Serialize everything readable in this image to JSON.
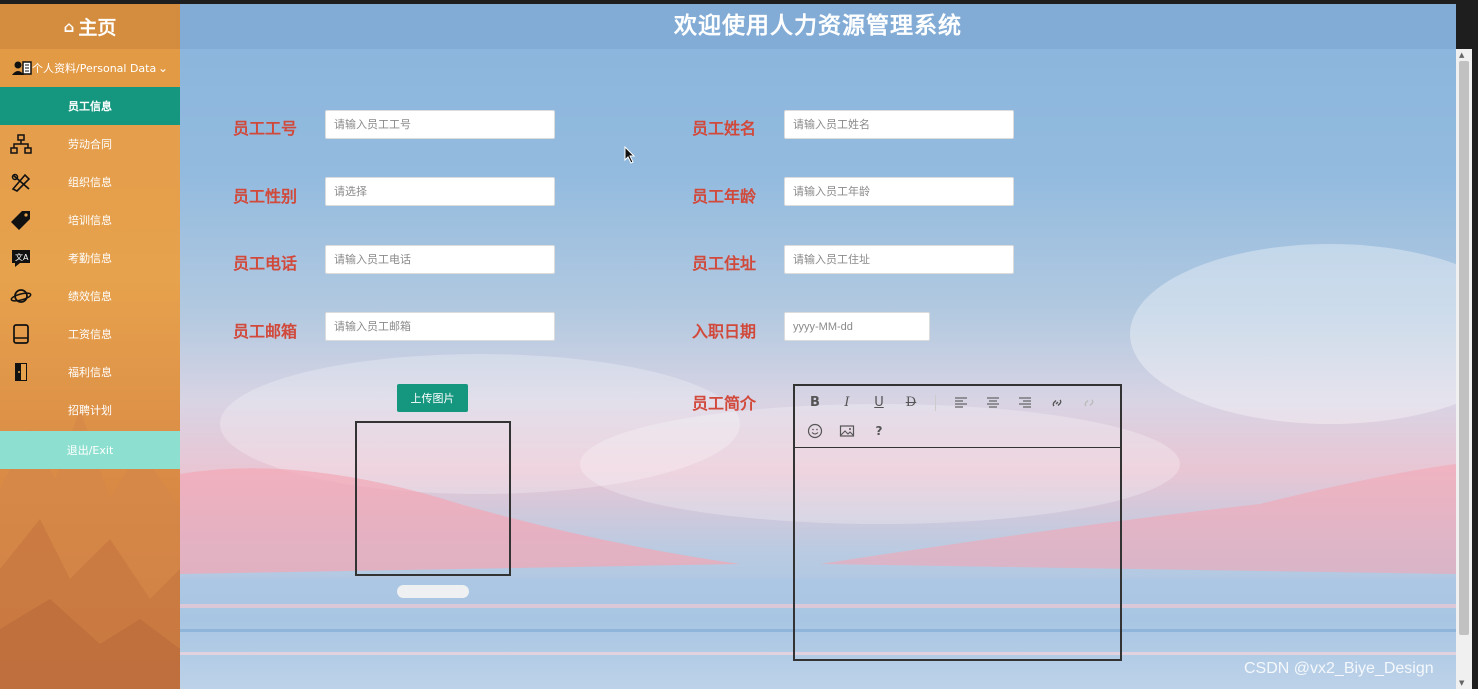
{
  "sidebar": {
    "home_label": "主页",
    "personal_label": "个人资料/Personal Data",
    "items": [
      {
        "label": "员工信息",
        "icon": "none"
      },
      {
        "label": "劳动合同",
        "icon": "hierarchy-icon"
      },
      {
        "label": "组织信息",
        "icon": "tools-icon"
      },
      {
        "label": "培训信息",
        "icon": "tag-icon"
      },
      {
        "label": "考勤信息",
        "icon": "translate-icon"
      },
      {
        "label": "绩效信息",
        "icon": "planet-icon"
      },
      {
        "label": "工资信息",
        "icon": "book-icon"
      },
      {
        "label": "福利信息",
        "icon": "door-icon"
      },
      {
        "label": "招聘计划",
        "icon": "none"
      }
    ],
    "exit_label": "退出/Exit"
  },
  "header": {
    "title": "欢迎使用人力资源管理系统"
  },
  "form": {
    "emp_no": {
      "label": "员工工号",
      "placeholder": "请输入员工工号"
    },
    "emp_name": {
      "label": "员工姓名",
      "placeholder": "请输入员工姓名"
    },
    "gender": {
      "label": "员工性别",
      "placeholder": "请选择"
    },
    "age": {
      "label": "员工年龄",
      "placeholder": "请输入员工年龄"
    },
    "phone": {
      "label": "员工电话",
      "placeholder": "请输入员工电话"
    },
    "address": {
      "label": "员工住址",
      "placeholder": "请输入员工住址"
    },
    "email": {
      "label": "员工邮箱",
      "placeholder": "请输入员工邮箱"
    },
    "hire_date": {
      "label": "入职日期",
      "placeholder": "yyyy-MM-dd"
    },
    "upload_label": "上传图片",
    "intro_label": "员工简介"
  },
  "editor_tools": [
    "B",
    "I",
    "U",
    "D",
    "?"
  ],
  "watermark": "CSDN @vx2_Biye_Design",
  "colors": {
    "accent": "#14967f",
    "label": "#d1493b",
    "sidebar": "#e39a44",
    "header": "#82acd6"
  }
}
